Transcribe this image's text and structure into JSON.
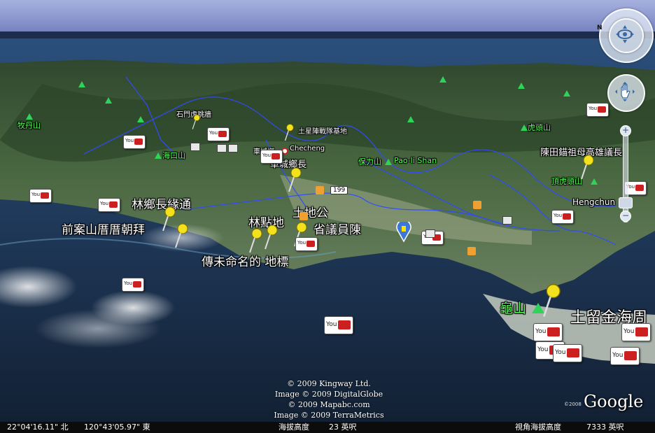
{
  "map": {
    "labels_large": [
      {
        "id": "lin-xiang-zhang",
        "text": "林鄉長緣通"
      },
      {
        "id": "qian-an-shan",
        "text": "前案山厝厝朝拜"
      },
      {
        "id": "lin-dian-di",
        "text": "林點地"
      },
      {
        "id": "tu-di-gong",
        "text": "土地公"
      },
      {
        "id": "sheng-yi-yuan",
        "text": "省議員陳"
      },
      {
        "id": "chuan-wei-ming",
        "text": "傳未命名的 地標"
      },
      {
        "id": "chen-tian-xi",
        "text": "陳田錨祖母高雄議長"
      },
      {
        "id": "tu-liu-jin",
        "text": "土留金海周"
      }
    ],
    "labels_small": [
      {
        "id": "shi-men",
        "text": "石門虎跳牆"
      },
      {
        "id": "tu-xing",
        "text": "土星陣戰隊基地"
      },
      {
        "id": "checheng-cn",
        "text": "車城鄉"
      },
      {
        "id": "checheng-en",
        "text": "Checheng"
      },
      {
        "id": "checheng-zhang",
        "text": "車城鄉長"
      },
      {
        "id": "hengchun",
        "text": "Hengchun"
      },
      {
        "id": "road-199",
        "text": "199"
      }
    ],
    "labels_mountain": [
      {
        "id": "mu-dan",
        "text": "牧丹山"
      },
      {
        "id": "hai-kou",
        "text": "海口山"
      },
      {
        "id": "bao-li",
        "text": "保力山"
      },
      {
        "id": "pao-li-en",
        "text": "Pao-li Shan"
      },
      {
        "id": "hu-tou",
        "text": "虎頭山"
      },
      {
        "id": "ding-hu-tou",
        "text": "頂虎頭山"
      },
      {
        "id": "gui-shan",
        "text": "龜山"
      }
    ]
  },
  "copyright": [
    "© 2009 Kingway Ltd.",
    "Image © 2009 DigitalGlobe",
    "© 2009 Mapabc.com",
    "Image © 2009 TerraMetrics"
  ],
  "logo": {
    "year": "©2008",
    "name": "Google"
  },
  "status": {
    "latitude": "22°04'16.11\" 北",
    "longitude": "120°43'05.97\" 東",
    "elevation_label": "海拔高度",
    "elevation_value": "23 英呎",
    "eye_label": "視角海拔高度",
    "eye_value": "7333 英呎"
  },
  "nav": {
    "north": "N",
    "zoom_in": "+",
    "zoom_out": "−"
  },
  "colors": {
    "road": "#2f4bff",
    "mountain": "#2fd35a",
    "pin": "#f2e11c",
    "sky": "#9aa7d4"
  }
}
